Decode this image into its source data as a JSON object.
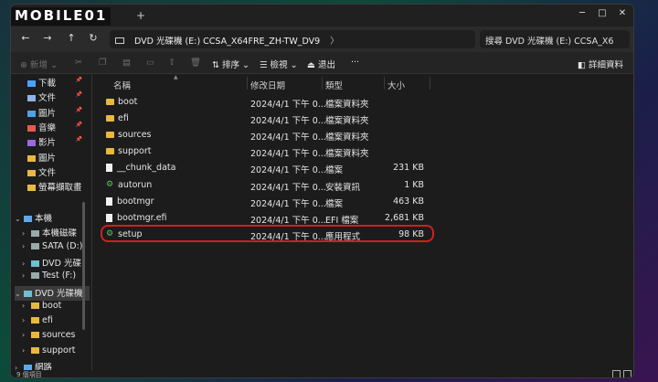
{
  "watermark": "MOBILE01",
  "tab_add": "+",
  "window_controls": {
    "minimize": "─",
    "maximize": "□",
    "close": "✕"
  },
  "nav": {
    "back": "←",
    "forward": "→",
    "up": "↑",
    "refresh": "↻"
  },
  "address": {
    "path": "DVD 光碟機 (E:) CCSA_X64FRE_ZH-TW_DV9",
    "chevron": "〉"
  },
  "search": {
    "placeholder": "搜尋 DVD 光碟機 (E:) CCSA_X6"
  },
  "commands": {
    "new": "新增",
    "sort": "排序",
    "view": "檢視",
    "eject": "退出",
    "more": "···",
    "details": "詳細資料"
  },
  "sidebar": {
    "quick": [
      {
        "label": "下載",
        "icon": "download-icon",
        "pinned": true
      },
      {
        "label": "文件",
        "icon": "document-icon",
        "pinned": true
      },
      {
        "label": "圖片",
        "icon": "picture-icon",
        "pinned": true
      },
      {
        "label": "音樂",
        "icon": "music-icon",
        "pinned": true
      },
      {
        "label": "影片",
        "icon": "video-icon",
        "pinned": true
      },
      {
        "label": "圖片",
        "icon": "folder-icon",
        "pinned": false
      },
      {
        "label": "文件",
        "icon": "folder-icon",
        "pinned": false
      },
      {
        "label": "螢幕擷取畫",
        "icon": "folder-icon",
        "pinned": false
      }
    ],
    "tree": [
      {
        "label": "本機",
        "icon": "computer-icon",
        "caret": "⌄",
        "indent": 0
      },
      {
        "label": "本機磁碟",
        "icon": "drive-icon",
        "caret": "›",
        "indent": 1
      },
      {
        "label": "SATA (D:)",
        "icon": "drive-icon",
        "caret": "›",
        "indent": 1
      },
      {
        "label": "DVD 光碟",
        "icon": "dvd-icon",
        "caret": "›",
        "indent": 1
      },
      {
        "label": "Test (F:)",
        "icon": "drive-icon",
        "caret": "›",
        "indent": 1
      },
      {
        "label": "DVD 光碟機",
        "icon": "dvd-icon",
        "caret": "⌄",
        "indent": 0,
        "selected": true
      },
      {
        "label": "boot",
        "icon": "folder-icon",
        "caret": "›",
        "indent": 1
      },
      {
        "label": "efi",
        "icon": "folder-icon",
        "caret": "›",
        "indent": 1
      },
      {
        "label": "sources",
        "icon": "folder-icon",
        "caret": "›",
        "indent": 1
      },
      {
        "label": "support",
        "icon": "folder-icon",
        "caret": "›",
        "indent": 1
      },
      {
        "label": "網路",
        "icon": "network-icon",
        "caret": "›",
        "indent": 0
      }
    ]
  },
  "columns": {
    "name": "名稱",
    "date": "修改日期",
    "type": "類型",
    "size": "大小"
  },
  "files": [
    {
      "name": "boot",
      "date": "2024/4/1 下午 0...",
      "type": "檔案資料夾",
      "size": "",
      "icon": "folder-icon"
    },
    {
      "name": "efi",
      "date": "2024/4/1 下午 0...",
      "type": "檔案資料夾",
      "size": "",
      "icon": "folder-icon"
    },
    {
      "name": "sources",
      "date": "2024/4/1 下午 0...",
      "type": "檔案資料夾",
      "size": "",
      "icon": "folder-icon"
    },
    {
      "name": "support",
      "date": "2024/4/1 下午 0...",
      "type": "檔案資料夾",
      "size": "",
      "icon": "folder-icon"
    },
    {
      "name": "__chunk_data",
      "date": "2024/4/1 下午 0...",
      "type": "檔案",
      "size": "231 KB",
      "icon": "file-icon"
    },
    {
      "name": "autorun",
      "date": "2024/4/1 下午 0...",
      "type": "安裝資訊",
      "size": "1 KB",
      "icon": "setup-info-icon"
    },
    {
      "name": "bootmgr",
      "date": "2024/4/1 下午 0...",
      "type": "檔案",
      "size": "463 KB",
      "icon": "file-icon"
    },
    {
      "name": "bootmgr.efi",
      "date": "2024/4/1 下午 0...",
      "type": "EFI 檔案",
      "size": "2,681 KB",
      "icon": "file-icon"
    },
    {
      "name": "setup",
      "date": "2024/4/1 下午 0...",
      "type": "應用程式",
      "size": "98 KB",
      "icon": "setup-app-icon"
    }
  ],
  "status": {
    "count": "9 個項目"
  },
  "colors": {
    "highlight": "#d41e1e",
    "folder": "#e8b840",
    "accent": "#5fc45f"
  }
}
